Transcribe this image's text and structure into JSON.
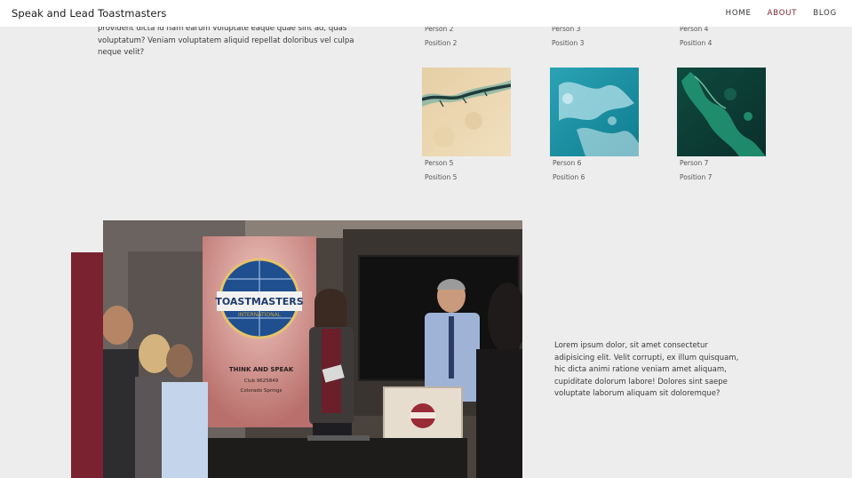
{
  "header": {
    "site_title": "Speak and Lead Toastmasters",
    "nav": [
      {
        "label": "HOME",
        "active": false
      },
      {
        "label": "ABOUT",
        "active": true
      },
      {
        "label": "BLOG",
        "active": false
      }
    ]
  },
  "intro": {
    "text": "provident dicta id nam earum voluptate eaque quae sint ad, quas voluptatum? Veniam voluptatem aliquid repellat doloribus vel culpa neque velit?"
  },
  "team": [
    {
      "name": "Person 2",
      "position": "Position 2"
    },
    {
      "name": "Person 3",
      "position": "Position 3"
    },
    {
      "name": "Person 4",
      "position": "Position 4"
    },
    {
      "name": "Person 5",
      "position": "Position 5"
    },
    {
      "name": "Person 6",
      "position": "Position 6"
    },
    {
      "name": "Person 7",
      "position": "Position 7"
    }
  ],
  "feature": {
    "photo_banner_title": "TOASTMASTERS",
    "photo_banner_subtitle": "INTERNATIONAL",
    "photo_banner_tagline": "THINK AND SPEAK",
    "photo_banner_club": "Club 9625849",
    "photo_banner_city": "Colorado Springs",
    "text": "Lorem ipsum dolor, sit amet consectetur adipisicing elit. Velit corrupti, ex illum quisquam, hic dicta animi ratione veniam amet aliquam, cupiditate dolorum labore! Dolores sint saepe voluptate laborum aliquam sit doloremque?"
  },
  "colors": {
    "accent": "#7a2230",
    "background": "#ededed",
    "header_bg": "#ffffff"
  }
}
